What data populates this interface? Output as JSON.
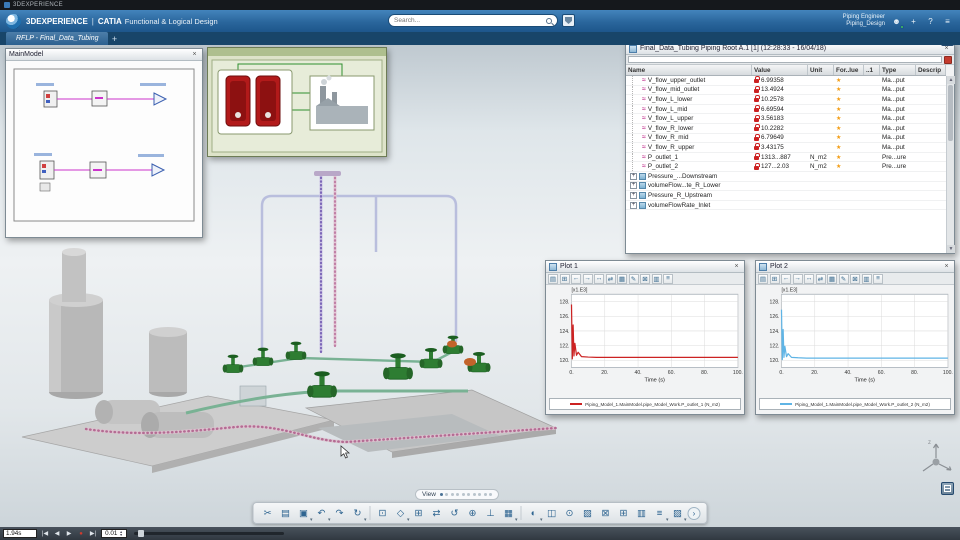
{
  "titlebar": {
    "app": "3DEXPERIENCE"
  },
  "header": {
    "brand": "3DEXPERIENCE",
    "divider": "|",
    "app": "CATIA",
    "module": "Functional & Logical Design",
    "search_placeholder": "Search...",
    "user_line1": "Piping Engineer",
    "user_line2": "Piping_Design",
    "icons": [
      {
        "name": "user-icon",
        "glyph": "☻",
        "presence": true
      },
      {
        "name": "add-icon",
        "glyph": "+"
      },
      {
        "name": "help-icon",
        "glyph": "?"
      },
      {
        "name": "menu-icon",
        "glyph": "≡"
      }
    ]
  },
  "tabbar": {
    "tab": "RFLP - Final_Data_Tubing",
    "add": "+"
  },
  "glyphs": {
    "close": "×",
    "plus": "+",
    "star": "★",
    "wave": "≈",
    "up": "▲",
    "down": "▼",
    "scroll_up": "▲",
    "scroll_dn": "▼"
  },
  "panels": {
    "main_model": {
      "title": "MainModel"
    },
    "data_table": {
      "title": "Final_Data_Tubing Piping Root A.1 [1] (12:28:33 - 16/04/18)",
      "columns": [
        "Name",
        "Value",
        "Unit",
        "For..lue",
        "..1",
        "Type",
        "Descrip"
      ],
      "rows": [
        {
          "name": "V_flow_upper_outlet",
          "value": "6.99358",
          "unit": "",
          "type": "Ma...put"
        },
        {
          "name": "V_flow_mid_outlet",
          "value": "13.4924",
          "unit": "",
          "type": "Ma...put"
        },
        {
          "name": "V_flow_L_lower",
          "value": "10.2578",
          "unit": "",
          "type": "Ma...put"
        },
        {
          "name": "V_flow_L_mid",
          "value": "6.69594",
          "unit": "",
          "type": "Ma...put"
        },
        {
          "name": "V_flow_L_upper",
          "value": "3.56183",
          "unit": "",
          "type": "Ma...put"
        },
        {
          "name": "V_flow_R_lower",
          "value": "10.2282",
          "unit": "",
          "type": "Ma...put"
        },
        {
          "name": "V_flow_R_mid",
          "value": "6.79649",
          "unit": "",
          "type": "Ma...put"
        },
        {
          "name": "V_flow_R_upper",
          "value": "3.43175",
          "unit": "",
          "type": "Ma...put"
        },
        {
          "name": "P_outlet_1",
          "value": "1313...887",
          "unit": "N_m2",
          "type": "Pre...ure"
        },
        {
          "name": "P_outlet_2",
          "value": "127...2.03",
          "unit": "N_m2",
          "type": "Pre...ure"
        }
      ],
      "groups": [
        "Pressure_...Downstream",
        "volumeFlow...te_R_Lower",
        "Pressure_R_Upstream",
        "volumeFlowRate_Inlet"
      ]
    }
  },
  "chart_data": [
    {
      "type": "line",
      "title": "Plot 1",
      "y_scale_label": "[x1.E3]",
      "xlabel": "Time (s)",
      "xlim": [
        0,
        100
      ],
      "ylim": [
        119,
        129
      ],
      "x_ticks": [
        0,
        20,
        40,
        60,
        80,
        100
      ],
      "y_ticks": [
        120,
        122,
        124,
        126,
        128
      ],
      "grid": true,
      "legend_position": "bottom",
      "series": [
        {
          "name": "Piping_Model_1.MainModel.pipe_Model_Work.P_outlet_1 (N_m2)",
          "color": "#cc2222",
          "x": [
            0,
            0.5,
            1,
            1.5,
            2,
            3,
            4,
            6,
            10,
            15,
            25,
            50,
            75,
            100
          ],
          "y": [
            127.6,
            120.2,
            124.8,
            120.6,
            122.3,
            120.7,
            121.1,
            120.5,
            120.45,
            120.4,
            120.4,
            120.4,
            120.4,
            120.4
          ]
        }
      ]
    },
    {
      "type": "line",
      "title": "Plot 2",
      "y_scale_label": "[x1.E3]",
      "xlabel": "Time (s)",
      "xlim": [
        0,
        100
      ],
      "ylim": [
        119,
        129
      ],
      "x_ticks": [
        0,
        20,
        40,
        60,
        80,
        100
      ],
      "y_ticks": [
        120,
        122,
        124,
        126,
        128
      ],
      "grid": true,
      "legend_position": "bottom",
      "series": [
        {
          "name": "Piping_Model_1.MainModel.pipe_Model_Work.P_outlet_2 (N_m2)",
          "color": "#5fb4e5",
          "x": [
            0,
            0.5,
            1,
            1.5,
            2,
            3,
            4,
            6,
            10,
            15,
            25,
            50,
            75,
            100
          ],
          "y": [
            126.9,
            120.1,
            124.2,
            120.4,
            121.9,
            120.5,
            120.9,
            120.4,
            120.35,
            120.3,
            120.3,
            120.3,
            120.3,
            120.3
          ]
        }
      ]
    }
  ],
  "plot_toolbar": [
    {
      "name": "layout-icon",
      "glyph": "▤"
    },
    {
      "name": "grid-icon",
      "glyph": "⊞"
    },
    {
      "name": "zoom-prev-icon",
      "glyph": "←"
    },
    {
      "name": "zoom-next-icon",
      "glyph": "→"
    },
    {
      "name": "fit-icon",
      "glyph": "↔"
    },
    {
      "name": "pan-icon",
      "glyph": "⇄"
    },
    {
      "name": "legend-icon",
      "glyph": "▦"
    },
    {
      "name": "edit-icon",
      "glyph": "✎"
    },
    {
      "name": "erase-icon",
      "glyph": "⊠"
    },
    {
      "name": "copy-icon",
      "glyph": "▥"
    },
    {
      "name": "options-icon",
      "glyph": "≡"
    }
  ],
  "viewport": {
    "view_label": "View",
    "dots": 10,
    "active_dot": 0,
    "compass_axis": "z"
  },
  "toolbar": {
    "icons": [
      {
        "name": "cut-icon",
        "glyph": "✂"
      },
      {
        "name": "copy-icon",
        "glyph": "▤"
      },
      {
        "name": "paste-icon",
        "glyph": "▣",
        "arrow": true
      },
      {
        "name": "undo-icon",
        "glyph": "↶",
        "arrow": true
      },
      {
        "name": "redo-icon",
        "glyph": "↷"
      },
      {
        "name": "update-icon",
        "glyph": "↻",
        "arrow": true
      },
      {
        "sep": true
      },
      {
        "name": "zoom-area-icon",
        "glyph": "⊡"
      },
      {
        "name": "view-cube-icon",
        "glyph": "◇",
        "arrow": true
      },
      {
        "name": "fit-all-icon",
        "glyph": "⊞"
      },
      {
        "name": "pan-icon",
        "glyph": "⇄"
      },
      {
        "name": "rotate-icon",
        "glyph": "↺"
      },
      {
        "name": "zoom-icon",
        "glyph": "⊕"
      },
      {
        "name": "normal-to-icon",
        "glyph": "⊥"
      },
      {
        "name": "views-icon",
        "glyph": "▦",
        "arrow": true
      },
      {
        "sep": true
      },
      {
        "name": "render-style-icon",
        "glyph": "◐",
        "arrow": true
      },
      {
        "name": "section-icon",
        "glyph": "◫"
      },
      {
        "name": "hide-show-icon",
        "glyph": "⊙"
      },
      {
        "name": "screen-icon",
        "glyph": "▧"
      },
      {
        "name": "capture-icon",
        "glyph": "⊠"
      },
      {
        "name": "grid-icon",
        "glyph": "⊞"
      },
      {
        "name": "snap-icon",
        "glyph": "▥"
      },
      {
        "name": "layers-icon",
        "glyph": "≡",
        "arrow": true
      },
      {
        "name": "tools-icon",
        "glyph": "▨",
        "arrow": true
      },
      {
        "name": "more-icon",
        "glyph": "›",
        "round": true
      }
    ]
  },
  "playbar": {
    "time": "1.94s",
    "speed": "0.01",
    "buttons": [
      {
        "name": "go-start-button",
        "glyph": "|◀"
      },
      {
        "name": "step-back-button",
        "glyph": "◀"
      },
      {
        "name": "play-button",
        "glyph": "▶"
      },
      {
        "name": "record-dot",
        "glyph": "●",
        "color": "#d23b2e"
      },
      {
        "name": "go-end-button",
        "glyph": "▶|"
      }
    ]
  }
}
